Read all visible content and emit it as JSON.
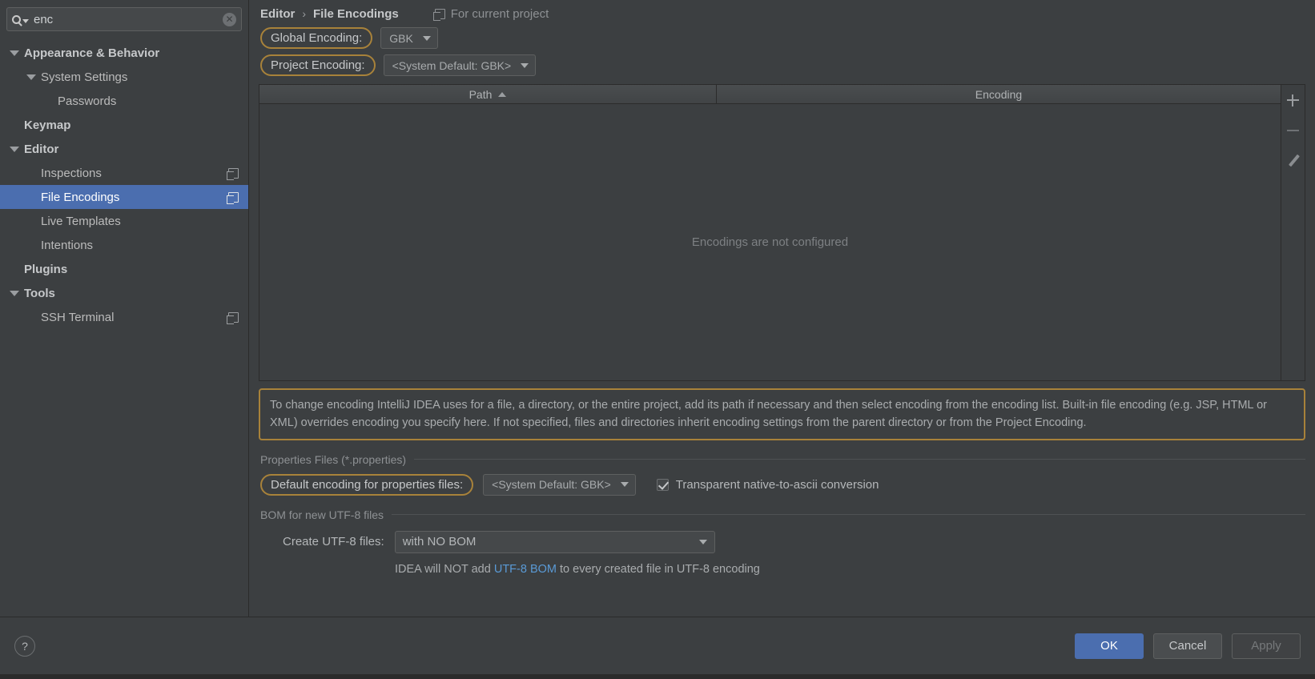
{
  "sidebar": {
    "search": {
      "value": "enc",
      "placeholder": "",
      "icon": "search-icon",
      "clear_icon": "✕"
    },
    "items": [
      {
        "label": "Appearance & Behavior",
        "indent": 0,
        "expandable": true,
        "bold": true,
        "selected": false,
        "badge": false
      },
      {
        "label": "System Settings",
        "indent": 1,
        "expandable": true,
        "bold": false,
        "selected": false,
        "badge": false
      },
      {
        "label": "Passwords",
        "indent": 2,
        "expandable": false,
        "bold": false,
        "selected": false,
        "badge": false
      },
      {
        "label": "Keymap",
        "indent": 0,
        "expandable": false,
        "bold": true,
        "selected": false,
        "badge": false
      },
      {
        "label": "Editor",
        "indent": 0,
        "expandable": true,
        "bold": true,
        "selected": false,
        "badge": false
      },
      {
        "label": "Inspections",
        "indent": 1,
        "expandable": false,
        "bold": false,
        "selected": false,
        "badge": true
      },
      {
        "label": "File Encodings",
        "indent": 1,
        "expandable": false,
        "bold": false,
        "selected": true,
        "badge": true
      },
      {
        "label": "Live Templates",
        "indent": 1,
        "expandable": false,
        "bold": false,
        "selected": false,
        "badge": false
      },
      {
        "label": "Intentions",
        "indent": 1,
        "expandable": false,
        "bold": false,
        "selected": false,
        "badge": false
      },
      {
        "label": "Plugins",
        "indent": 0,
        "expandable": false,
        "bold": true,
        "selected": false,
        "badge": false
      },
      {
        "label": "Tools",
        "indent": 0,
        "expandable": true,
        "bold": true,
        "selected": false,
        "badge": false
      },
      {
        "label": "SSH Terminal",
        "indent": 1,
        "expandable": false,
        "bold": false,
        "selected": false,
        "badge": true
      }
    ]
  },
  "breadcrumb": {
    "parent": "Editor",
    "separator": "›",
    "current": "File Encodings",
    "scope_label": "For current project"
  },
  "encodings": {
    "global_label": "Global Encoding:",
    "global_value": "GBK",
    "project_label": "Project Encoding:",
    "project_value": "<System Default: GBK>"
  },
  "table": {
    "columns": [
      "Path",
      "Encoding"
    ],
    "sort_column": "Path",
    "sort_direction": "ascending",
    "rows": [],
    "empty_message": "Encodings are not configured",
    "tools": [
      {
        "name": "add-row-button",
        "glyph": "+"
      },
      {
        "name": "remove-row-button",
        "glyph": "−"
      },
      {
        "name": "edit-row-button",
        "glyph": "✎"
      }
    ]
  },
  "info": {
    "text": "To change encoding IntelliJ IDEA uses for a file, a directory, or the entire project, add its path if necessary and then select encoding from the encoding list. Built-in file encoding (e.g. JSP, HTML or XML) overrides encoding you specify here. If not specified, files and directories inherit encoding settings from the parent directory or from the Project Encoding."
  },
  "properties_section": {
    "title": "Properties Files (*.properties)",
    "default_encoding_label": "Default encoding for properties files:",
    "default_encoding_value": "<System Default: GBK>",
    "transparent_checkbox_label": "Transparent native-to-ascii conversion",
    "transparent_checkbox_checked": true
  },
  "bom_section": {
    "title": "BOM for new UTF-8 files",
    "create_label": "Create UTF-8 files:",
    "create_value": "with NO BOM",
    "note_prefix": "IDEA will NOT add ",
    "note_link": "UTF-8 BOM",
    "note_suffix": " to every created file in UTF-8 encoding"
  },
  "footer": {
    "help_glyph": "?",
    "ok_label": "OK",
    "cancel_label": "Cancel",
    "apply_label": "Apply"
  },
  "colors": {
    "accent_selection": "#4b6eaf",
    "highlight_border": "#a8823a",
    "link": "#5a9ad6",
    "background": "#3c3f41"
  }
}
